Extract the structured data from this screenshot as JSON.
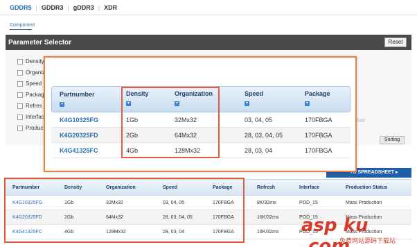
{
  "tabs": [
    {
      "label": "GDDR5"
    },
    {
      "label": "GDDR3"
    },
    {
      "label": "gDDR3"
    },
    {
      "label": "XDR"
    }
  ],
  "breadcrumb": "Component",
  "param_selector": {
    "title": "Parameter Selector",
    "reset_label": "Reset",
    "params": [
      "Density",
      "Organiz",
      "Speed",
      "Packag",
      "Refres",
      "Interfac",
      "Producti"
    ],
    "value_hint": "alue",
    "sorting_label": "Sorting"
  },
  "spreadsheet_label": "TO SPREADSHEET ▸",
  "overlay_table": {
    "headers": [
      "Partnumber",
      "Density",
      "Organization",
      "Speed",
      "Package"
    ],
    "rows": [
      [
        "K4G10325FG",
        "1Gb",
        "32Mx32",
        "03, 04, 05",
        "170FBGA"
      ],
      [
        "K4G20325FD",
        "2Gb",
        "64Mx32",
        "28, 03, 04, 05",
        "170FBGA"
      ],
      [
        "K4G41325FC",
        "4Gb",
        "128Mx32",
        "28, 03, 04",
        "170FBGA"
      ]
    ]
  },
  "bottom_table": {
    "headers": [
      "Partnumber",
      "Density",
      "Organization",
      "Speed",
      "Package",
      "Refresh",
      "Interface",
      "Production Status"
    ],
    "rows": [
      [
        "K4G10325FG",
        "1Gb",
        "32Mx32",
        "03, 04, 05",
        "170FBGA",
        "8K/32ms",
        "POD_15",
        "Mass Production"
      ],
      [
        "K4G20325FD",
        "2Gb",
        "64Mx32",
        "28, 03, 04, 05",
        "170FBGA",
        "16K/32ms",
        "POD_15",
        "Mass Production"
      ],
      [
        "K4G41325FC",
        "4Gb",
        "128Mx32",
        "28, 03, 04",
        "170FBGA",
        "16K/32ms",
        "POD_15",
        "Mass Production"
      ]
    ]
  },
  "watermark": {
    "logo": "asp ku .com",
    "sub": "免费网站源码下载站"
  }
}
